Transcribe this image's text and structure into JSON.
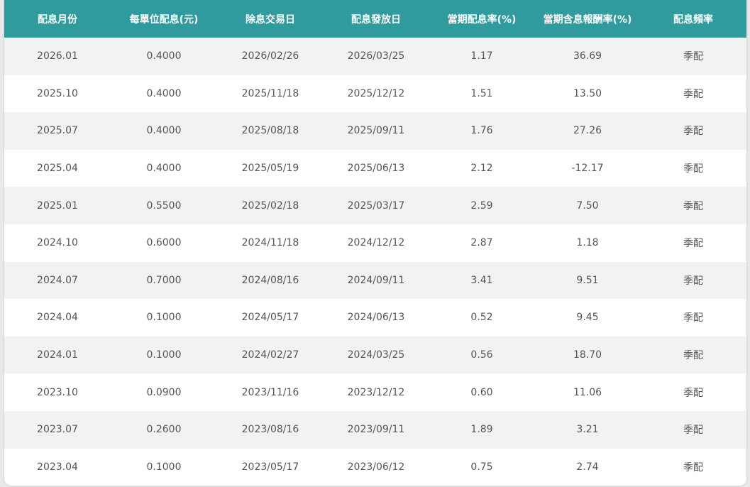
{
  "table": {
    "headers": [
      "配息月份",
      "每單位配息(元)",
      "除息交易日",
      "配息發放日",
      "當期配息率(%)",
      "當期含息報酬率(%)",
      "配息頻率"
    ],
    "rows": [
      [
        "2026.01",
        "0.4000",
        "2026/02/26",
        "2026/03/25",
        "1.17",
        "36.69",
        "季配"
      ],
      [
        "2025.10",
        "0.4000",
        "2025/11/18",
        "2025/12/12",
        "1.51",
        "13.50",
        "季配"
      ],
      [
        "2025.07",
        "0.4000",
        "2025/08/18",
        "2025/09/11",
        "1.76",
        "27.26",
        "季配"
      ],
      [
        "2025.04",
        "0.4000",
        "2025/05/19",
        "2025/06/13",
        "2.12",
        "-12.17",
        "季配"
      ],
      [
        "2025.01",
        "0.5500",
        "2025/02/18",
        "2025/03/17",
        "2.59",
        "7.50",
        "季配"
      ],
      [
        "2024.10",
        "0.6000",
        "2024/11/18",
        "2024/12/12",
        "2.87",
        "1.18",
        "季配"
      ],
      [
        "2024.07",
        "0.7000",
        "2024/08/16",
        "2024/09/11",
        "3.41",
        "9.51",
        "季配"
      ],
      [
        "2024.04",
        "0.1000",
        "2024/05/17",
        "2024/06/13",
        "0.52",
        "9.45",
        "季配"
      ],
      [
        "2024.01",
        "0.1000",
        "2024/02/27",
        "2024/03/25",
        "0.56",
        "18.70",
        "季配"
      ],
      [
        "2023.10",
        "0.0900",
        "2023/11/16",
        "2023/12/12",
        "0.60",
        "11.06",
        "季配"
      ],
      [
        "2023.07",
        "0.2600",
        "2023/08/16",
        "2023/09/11",
        "1.89",
        "3.21",
        "季配"
      ],
      [
        "2023.04",
        "0.1000",
        "2023/05/17",
        "2023/06/12",
        "0.75",
        "2.74",
        "季配"
      ]
    ]
  },
  "colors": {
    "header_bg": "#2f9b9e",
    "header_text": "#ffffff",
    "row_alt_bg": "#f2f2f2",
    "cell_text": "#555555"
  }
}
